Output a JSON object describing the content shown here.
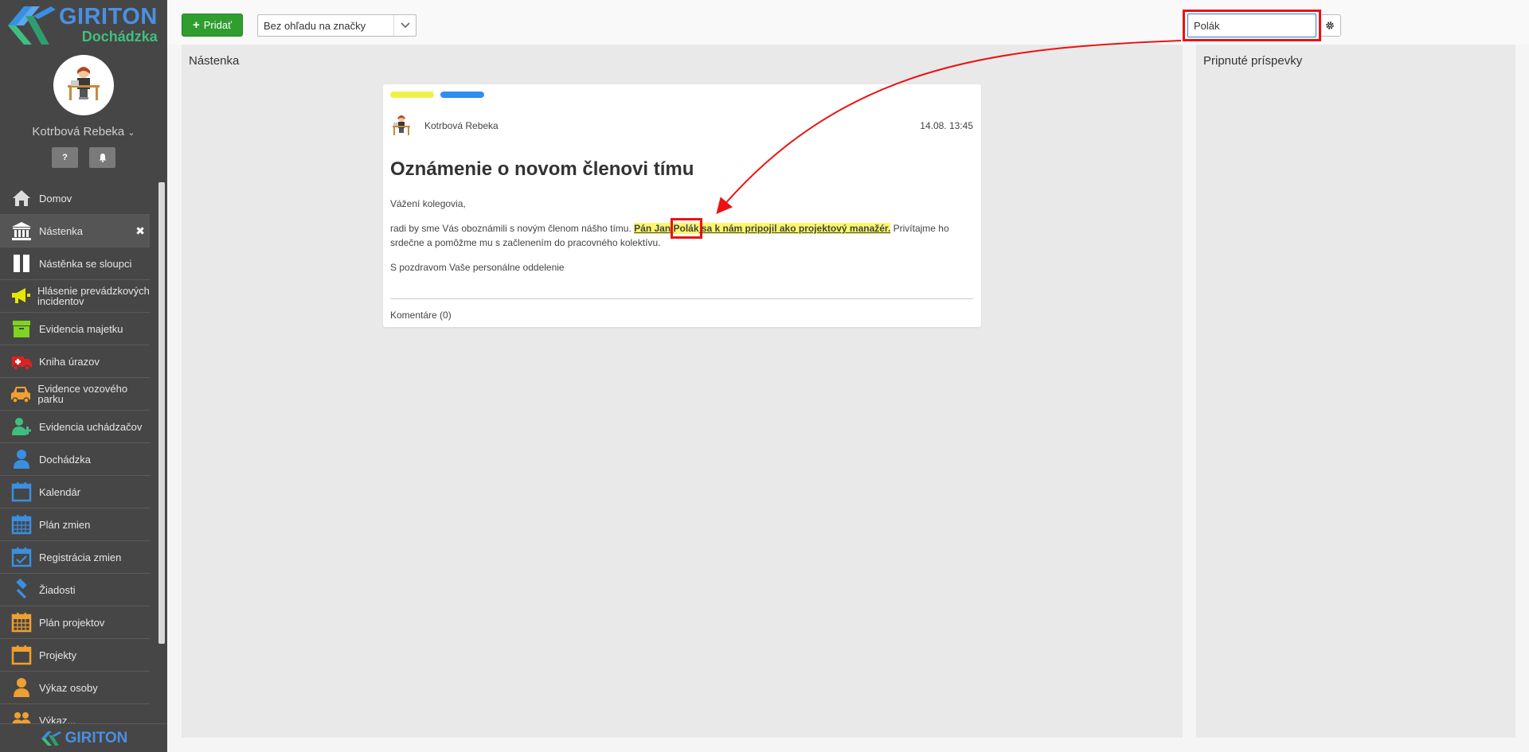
{
  "app": {
    "brand": "GIRITON",
    "module": "Dochádzka",
    "footer_brand": "GIRITON"
  },
  "user": {
    "name": "Kotrbová Rebeka",
    "help_button": "?",
    "notifications_icon": "bell-icon"
  },
  "sidebar": {
    "items": [
      {
        "label": "Domov",
        "icon": "home-icon",
        "color": "#dddddd"
      },
      {
        "label": "Nástenka",
        "icon": "building-icon",
        "color": "#ffffff",
        "active": true,
        "close": "✖"
      },
      {
        "label": "Nástěnka se sloupci",
        "icon": "columns-icon",
        "color": "#ffffff"
      },
      {
        "label": "Hlásenie prevádzkových incidentov",
        "icon": "megaphone-icon",
        "color": "#e6e600"
      },
      {
        "label": "Evidencia majetku",
        "icon": "archive-icon",
        "color": "#7fd321"
      },
      {
        "label": "Kniha úrazov",
        "icon": "ambulance-icon",
        "color": "#e02020"
      },
      {
        "label": "Evidence vozového parku",
        "icon": "car-icon",
        "color": "#f0a030"
      },
      {
        "label": "Evidencia uchádzačov",
        "icon": "user-plus-icon",
        "color": "#3fbf7f"
      },
      {
        "label": "Dochádzka",
        "icon": "user-icon",
        "color": "#3a8fe0"
      },
      {
        "label": "Kalendár",
        "icon": "calendar-icon",
        "color": "#3a8fe0"
      },
      {
        "label": "Plán zmien",
        "icon": "calendar-grid-icon",
        "color": "#3a8fe0"
      },
      {
        "label": "Registrácia zmien",
        "icon": "calendar-check-icon",
        "color": "#3a8fe0"
      },
      {
        "label": "Žiadosti",
        "icon": "gavel-icon",
        "color": "#3a8fe0"
      },
      {
        "label": "Plán projektov",
        "icon": "calendar-grid-icon",
        "color": "#f0a030"
      },
      {
        "label": "Projekty",
        "icon": "calendar-icon",
        "color": "#f0a030"
      },
      {
        "label": "Výkaz osoby",
        "icon": "user-icon",
        "color": "#f0a030"
      },
      {
        "label": "Výkaz...",
        "icon": "users-icon",
        "color": "#f0a030"
      }
    ]
  },
  "toolbar": {
    "add_label": "Pridať",
    "tag_filter": "Bez ohľadu na značky",
    "search_value": "Polák"
  },
  "board": {
    "title": "Nástenka"
  },
  "pinned": {
    "title": "Pripnuté príspevky"
  },
  "post": {
    "tags": [
      {
        "color": "#f0f04a"
      },
      {
        "color": "#2f8ff0"
      }
    ],
    "author": "Kotrbová Rebeka",
    "date": "14.08. 13:45",
    "title": "Oznámenie o novom členovi tímu",
    "greeting": "Vážení kolegovia,",
    "body_before": "radi by sme Vás oboznámili s novým členom nášho tímu. ",
    "highlight_before": "Pán Jan ",
    "highlight_match": "Polák",
    "highlight_after": " sa k nám pripojil ako projektový manažér.",
    "body_after": " Privítajme ho srdečne a pomôžme mu s začlenením do pracovného kolektívu.",
    "signature": "S pozdravom Vaše personálne oddelenie",
    "comments": "Komentáre (0)"
  }
}
